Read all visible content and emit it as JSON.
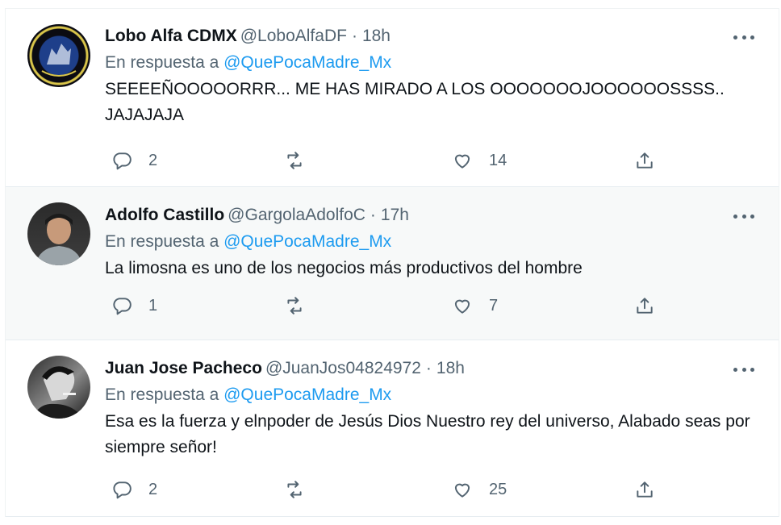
{
  "tweets": [
    {
      "name": "Lobo Alfa CDMX",
      "handle": "@LoboAlfaDF",
      "separator": "·",
      "time": "18h",
      "reply_prefix": "En respuesta a",
      "reply_to": "@QuePocaMadre_Mx",
      "text": "SEEEEÑOOOOORRR... ME HAS MIRADO A LOS OOOOOOOJOOOOOOSSSS.. JAJAJAJA",
      "replies": "2",
      "retweets": "",
      "likes": "14",
      "avatar_logo_text": "LOBO ALFA DF"
    },
    {
      "name": "Adolfo Castillo",
      "handle": "@GargolaAdolfoC",
      "separator": "·",
      "time": "17h",
      "reply_prefix": "En respuesta a",
      "reply_to": "@QuePocaMadre_Mx",
      "text": "La limosna es uno de los negocios más productivos del hombre",
      "replies": "1",
      "retweets": "",
      "likes": "7"
    },
    {
      "name": "Juan Jose Pacheco",
      "handle": "@JuanJos04824972",
      "separator": "·",
      "time": "18h",
      "reply_prefix": "En respuesta a",
      "reply_to": "@QuePocaMadre_Mx",
      "text": "Esa es la fuerza y elnpoder de Jesús Dios Nuestro rey del universo, Alabado seas por siempre señor!",
      "replies": "2",
      "retweets": "",
      "likes": "25"
    }
  ],
  "icons": {
    "reply": "reply-icon",
    "retweet": "retweet-icon",
    "like": "heart-icon",
    "share": "share-icon",
    "more": "more-icon"
  },
  "colors": {
    "text": "#0f1419",
    "secondary": "#536471",
    "link": "#1d9bf0",
    "highlight_bg": "#f7f9f9"
  }
}
